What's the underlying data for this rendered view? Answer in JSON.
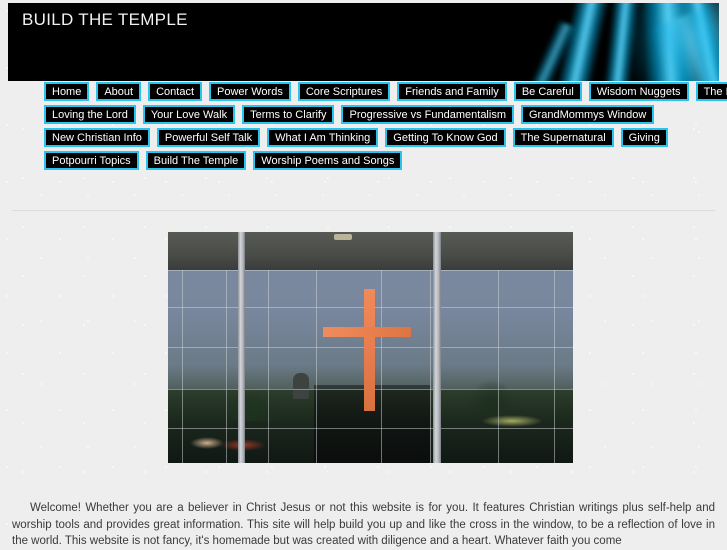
{
  "site": {
    "title": "BUILD THE TEMPLE"
  },
  "nav": {
    "rows": [
      [
        {
          "label": "Home"
        },
        {
          "label": "About"
        },
        {
          "label": "Contact"
        },
        {
          "label": "Power Words"
        },
        {
          "label": "Core Scriptures"
        },
        {
          "label": "Friends and Family"
        },
        {
          "label": "Be Careful"
        },
        {
          "label": "Wisdom Nuggets"
        },
        {
          "label": "The Bible"
        }
      ],
      [
        {
          "label": "Loving the Lord"
        },
        {
          "label": "Your Love Walk"
        },
        {
          "label": "Terms to Clarify"
        },
        {
          "label": "Progressive vs Fundamentalism"
        },
        {
          "label": "GrandMommys Window"
        }
      ],
      [
        {
          "label": "New Christian Info"
        },
        {
          "label": "Powerful Self Talk"
        },
        {
          "label": "What I Am Thinking"
        },
        {
          "label": "Getting To Know God"
        },
        {
          "label": "The Supernatural"
        },
        {
          "label": "Giving"
        }
      ],
      [
        {
          "label": "Potpourri Topics"
        },
        {
          "label": "Build The Temple"
        },
        {
          "label": "Worship Poems and Songs"
        }
      ]
    ]
  },
  "main": {
    "photo_alt": "glass church entrance with orange cross in window",
    "welcome_paragraph": "Welcome! Whether you are a believer in Christ Jesus or not this website is for you. It features Christian writings plus self-help and worship tools and provides great information.  This site will help build you up and like the cross in the window, to be a reflection of love in the world. This website is not fancy, it's homemade but was created with diligence and a heart. Whatever faith you come"
  },
  "colors": {
    "page_background": "#eeeeef",
    "banner_background": "#000000",
    "accent_cyan": "#29c3ee",
    "nav_background": "#000000",
    "nav_text": "#ffffff",
    "cross": "#e8804f"
  }
}
